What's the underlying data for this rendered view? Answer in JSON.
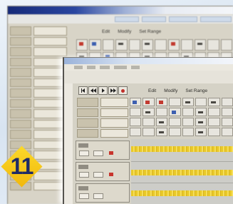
{
  "badge": {
    "label": "11",
    "color": "#f5c916",
    "text_color": "#1f2b66"
  },
  "back_window": {
    "menu": [
      "Edit",
      "Modify",
      "Set Range"
    ]
  },
  "front_window": {
    "menu": [
      "Edit",
      "Modify",
      "Set Range"
    ],
    "transport_icons": [
      "skip-back-icon",
      "rewind-icon",
      "play-icon",
      "fast-forward-icon",
      "record-icon"
    ]
  },
  "colors": {
    "title_bar": "#1c2e7c",
    "window": "#d8d5cb",
    "waveform": "#f0d23a"
  }
}
